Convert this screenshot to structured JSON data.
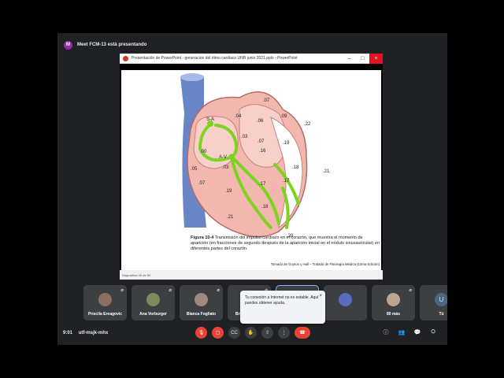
{
  "presenting": {
    "badge": "M",
    "text": "Meet FCM-13 está presentando"
  },
  "ppt": {
    "title": "Presentación de PowerPoint  -  generacion del ritmo cardiaco UNR junio 2021.pptx - PowerPoint",
    "status": "Diapositiva 45 de 60"
  },
  "slide": {
    "labels": {
      "sa": "S-A",
      "av": "A-V",
      "n1": ".07",
      "n2": ".04",
      "n3": ".06",
      "n4": ".09",
      "n5": ".22",
      "n6": ".03",
      "n7": ".07",
      "n8": ".16",
      "n9": ".19",
      "n10": ".00",
      "n11": ".03",
      "n12": ".05",
      "n13": ".18",
      "n14": ".21",
      "n15": ".07",
      "n16": ".19",
      "n17": ".17",
      "n18": ".17",
      "n19": ".18",
      "n20": ".21",
      "n21": ".20"
    },
    "caption_bold": "Figura 10-4",
    "caption_text": " Transmisión del impulso cardíaco en el corazón, que muestra el momento de aparición (en fracciones de segundo des­pués de la aparición inicial en el nódulo sinusauricular) en diferentes partes del corazón.",
    "credit": "Tomado de Guyton y Hall – Tratado de Fisiología Médica (12ma Edición)"
  },
  "participants": [
    {
      "name": "Priscila Ereagovic"
    },
    {
      "name": "Ana Vorburger"
    },
    {
      "name": "Bianca Fogliato"
    },
    {
      "name": "Bruno Cavalca"
    },
    {
      "name": ""
    },
    {
      "name": ""
    },
    {
      "name": "80 más"
    },
    {
      "name": "Tú",
      "avatar": "U"
    }
  ],
  "toast": {
    "text": "Tu conexión a Internet no es estable. Aquí puedes obtener ayuda.",
    "close": "×"
  },
  "bottom": {
    "time": "9:01",
    "code": "utf-msjk-mhx"
  },
  "icons": {
    "mic": "mic-off-icon",
    "cam": "camera-off-icon",
    "cc": "captions-icon",
    "hand": "raise-hand-icon",
    "present": "present-icon",
    "more": "more-icon",
    "end": "end-call-icon"
  },
  "colors": {
    "accent": "#ea4335",
    "bg": "#202124",
    "tile": "#3c4043",
    "conduction": "#7ed321"
  }
}
